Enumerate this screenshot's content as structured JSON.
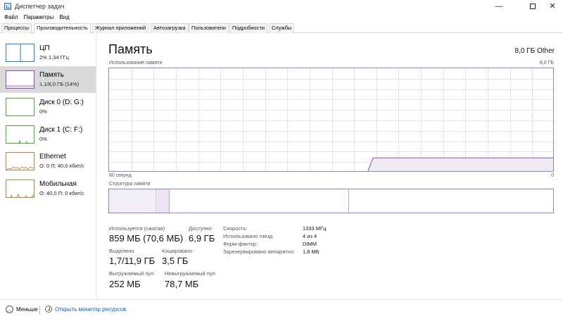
{
  "window": {
    "title": "Диспетчер задач",
    "minimize_label": "—",
    "close_label": "✕"
  },
  "menu": [
    "Файл",
    "Параметры",
    "Вид"
  ],
  "tabs": [
    {
      "label": "Процессы",
      "active": false
    },
    {
      "label": "Производительность",
      "active": true
    },
    {
      "label": "Журнал приложений",
      "active": false
    },
    {
      "label": "Автозагрузка",
      "active": false
    },
    {
      "label": "Пользователи",
      "active": false
    },
    {
      "label": "Подробности",
      "active": false
    },
    {
      "label": "Службы",
      "active": false
    }
  ],
  "sidebar": {
    "items": [
      {
        "name": "ЦП",
        "sub": "2% 1,34 ГГц",
        "color": "#1b7fc4",
        "active": false
      },
      {
        "name": "Память",
        "sub": "1,1/8,0 ГБ (14%)",
        "color": "#8b4fa8",
        "active": true
      },
      {
        "name": "Диск 0 (D: G:)",
        "sub": "0%",
        "color": "#4da832",
        "active": false
      },
      {
        "name": "Диск 1 (C: F:)",
        "sub": "0%",
        "color": "#4da832",
        "active": false
      },
      {
        "name": "Ethernet",
        "sub": "О: 0 П: 40,0 кбит/с",
        "color": "#a8813a",
        "active": false
      },
      {
        "name": "Мобильная",
        "sub": "О: 40,0 П: 0 кбит/с",
        "color": "#a8813a",
        "active": false
      }
    ]
  },
  "main": {
    "title": "Память",
    "total": "8,0 ГБ Other",
    "usage_label": "Использование памяти",
    "usage_max": "8,0 ГБ",
    "time_left": "60 секунд",
    "time_right": "0",
    "structure_label": "Структура памяти",
    "usage_fraction": 0.14,
    "accent_color": "#8b4fa8"
  },
  "stats": {
    "in_use_label": "Используется (сжатая)",
    "in_use_value": "859 МБ (70,6 МБ)",
    "available_label": "Доступно",
    "available_value": "6,9 ГБ",
    "committed_label": "Выделено",
    "committed_value": "1,7/11,9 ГБ",
    "cached_label": "Кэшировано",
    "cached_value": "3,5 ГБ",
    "paged_label": "Выгружаемый пул",
    "paged_value": "252 МБ",
    "nonpaged_label": "Невыгружаемый пул",
    "nonpaged_value": "78,7 МБ"
  },
  "details": [
    {
      "label": "Скорость:",
      "value": "1333 МГц"
    },
    {
      "label": "Использовано гнезд:",
      "value": "4 из 4"
    },
    {
      "label": "Форм-фактор:",
      "value": "DIMM"
    },
    {
      "label": "Зарезервировано аппаратно:",
      "value": "1,8 МБ"
    }
  ],
  "footer": {
    "fewer_label": "Меньше",
    "monitor_label": "Открыть монитор ресурсов"
  }
}
